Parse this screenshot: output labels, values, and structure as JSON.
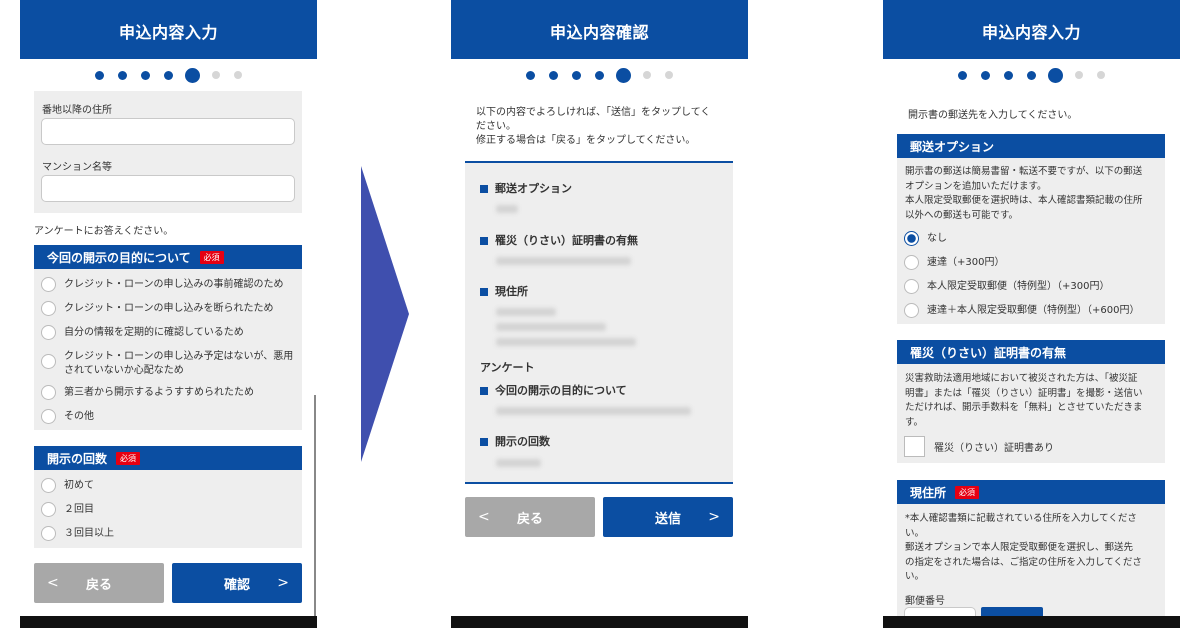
{
  "screen1": {
    "title": "申込内容入力",
    "address_label": "番地以降の住所",
    "mansion_label": "マンション名等",
    "survey_intro": "アンケートにお答えください。",
    "purpose": {
      "heading": "今回の開示の目的について",
      "required": "必須",
      "options": [
        "クレジット・ローンの申し込みの事前確認のため",
        "クレジット・ローンの申し込みを断られたため",
        "自分の情報を定期的に確認しているため",
        "クレジット・ローンの申し込み予定はないが、悪用されていないか心配なため",
        "第三者から開示するようすすめられたため",
        "その他"
      ]
    },
    "count": {
      "heading": "開示の回数",
      "required": "必須",
      "options": [
        "初めて",
        "２回目",
        "３回目以上"
      ]
    },
    "back_label": "戻る",
    "confirm_label": "確認"
  },
  "screen2": {
    "title": "申込内容確認",
    "intro_line1": "以下の内容でよろしければ、「送信」をタップしてく",
    "intro_line2": "ださい。",
    "intro_line3": "修正する場合は「戻る」をタップしてください。",
    "items": {
      "mail_option": "郵送オプション",
      "disaster": "罹災（りさい）証明書の有無",
      "address": "現住所",
      "survey": "アンケート",
      "purpose": "今回の開示の目的について",
      "count": "開示の回数"
    },
    "back_label": "戻る",
    "send_label": "送信"
  },
  "screen3": {
    "title": "申込内容入力",
    "intro": "開示書の郵送先を入力してください。",
    "mail": {
      "heading": "郵送オプション",
      "desc_line1": "開示書の郵送は簡易書留・転送不要ですが、以下の郵送",
      "desc_line2": "オプションを追加いただけます。",
      "desc_line3": "本人限定受取郵便を選択時は、本人確認書類記載の住所",
      "desc_line4": "以外への郵送も可能です。",
      "options": [
        "なし",
        "速達（+300円）",
        "本人限定受取郵便（特例型）（+300円）",
        "速達＋本人限定受取郵便（特例型）（+600円）"
      ]
    },
    "disaster": {
      "heading": "罹災（りさい）証明書の有無",
      "desc_line1": "災害救助法適用地域において被災された方は、「被災証",
      "desc_line2": "明書」または「罹災（りさい）証明書」を撮影・送信い",
      "desc_line3": "ただければ、開示手数料を「無料」とさせていただきま",
      "desc_line4": "す。",
      "checkbox_label": "罹災（りさい）証明書あり"
    },
    "address": {
      "heading": "現住所",
      "required": "必須",
      "desc_line1": "*本人確認書類に記載されている住所を入力してくださ",
      "desc_line2": "い。",
      "desc_line3": "郵送オプションで本人限定受取郵便を選択し、郵送先",
      "desc_line4": "の指定をされた場合は、ご指定の住所を入力してくださ",
      "desc_line5": "い。",
      "zip_label": "郵便番号"
    }
  },
  "colors": {
    "brand_blue": "#0b4ea2",
    "required_red": "#e60012",
    "arrow_blue": "#3f4fae",
    "back_gray": "#a8a8a8"
  },
  "progress": {
    "total_steps": 7,
    "current_step": 5
  }
}
